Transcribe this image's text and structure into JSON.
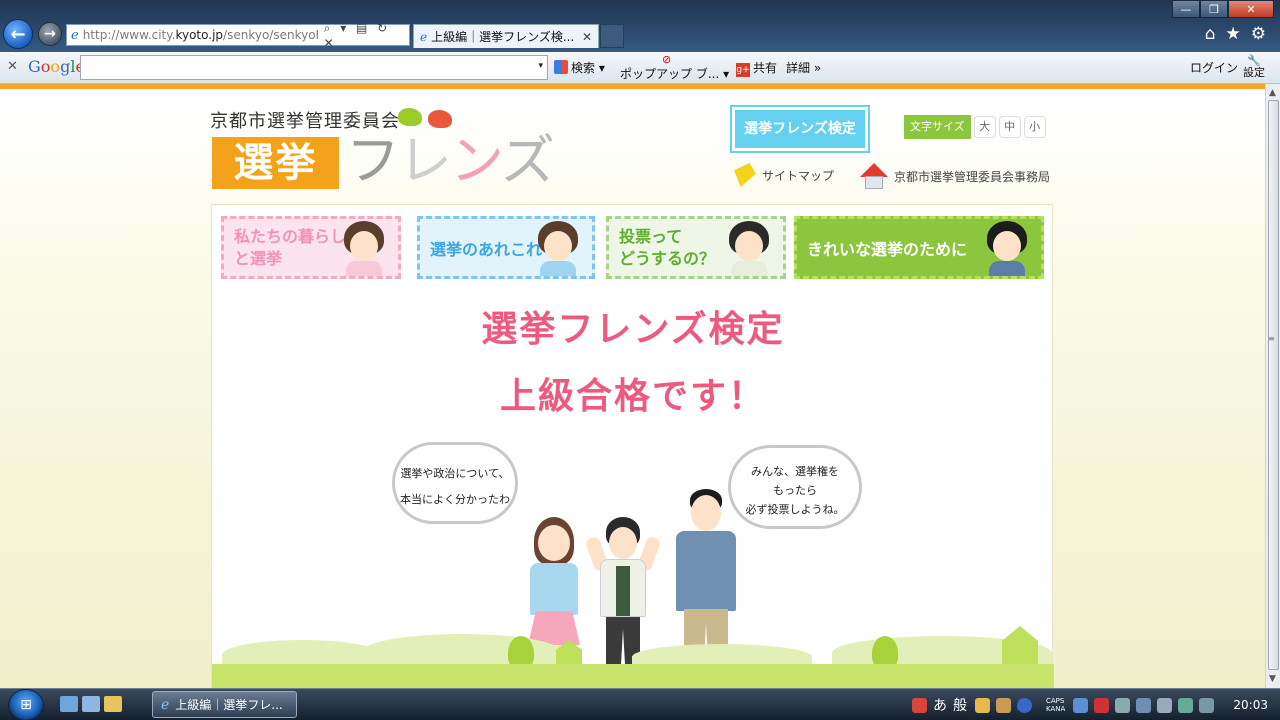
{
  "browser": {
    "url_prefix": "http://www.city.",
    "url_domain": "kyoto.jp",
    "url_rest": "/senkyo/senkyoFri",
    "tab_title": "上級編｜選挙フレンズ検...",
    "address_tools": "⌕ ▾ ▤ ↻ ✕",
    "tab_close": "✕",
    "window_controls": [
      "—",
      "❐",
      "✕"
    ],
    "right_icons": [
      "⌂",
      "★",
      "⚙"
    ]
  },
  "toolbar": {
    "close": "✕",
    "google": [
      "G",
      "o",
      "o",
      "g",
      "l",
      "e"
    ],
    "search_button": "検索",
    "dropdown": "▾",
    "popup": "ポップアップ ブ...",
    "share": "共有",
    "detail": "詳細 »",
    "login": "ログイン",
    "settings": "設定"
  },
  "site": {
    "org": "京都市選挙管理委員会",
    "logo_box": "選挙",
    "logo_friends": [
      "フ",
      "レ",
      "ン",
      "ズ",
      ""
    ],
    "kentei_button": "選挙フレンズ検定",
    "fontsize_label": "文字サイズ",
    "fontsize_options": [
      "大",
      "中",
      "小"
    ],
    "sitemap": "サイトマップ",
    "office": "京都市選挙管理委員会事務局"
  },
  "nav": {
    "kurashi": [
      "私たちの暮らし",
      "と選挙"
    ],
    "arekore": "選挙のあれこれ",
    "touhyou": [
      "投票って",
      "どうするの？"
    ],
    "kirei": "きれいな選挙のために"
  },
  "result": {
    "title": "選挙フレンズ検定",
    "subtitle": "上級合格です！"
  },
  "bubbles": {
    "left": [
      "選挙や政治について、",
      "本当によく分かったわ"
    ],
    "right": [
      "みんな、選挙権を",
      "もったら",
      "必ず投票しようね。"
    ]
  },
  "taskbar": {
    "task_ie": "上級編｜選挙フレ...",
    "ime_a": "あ",
    "ime_han": "般",
    "caps": [
      "CAPS",
      "KANA"
    ],
    "clock": "20:03"
  },
  "colors": {
    "accent_orange": "#f5a623",
    "pink_title": "#ee5a7e",
    "green": "#8cc63f",
    "sky": "#66d0f0"
  }
}
